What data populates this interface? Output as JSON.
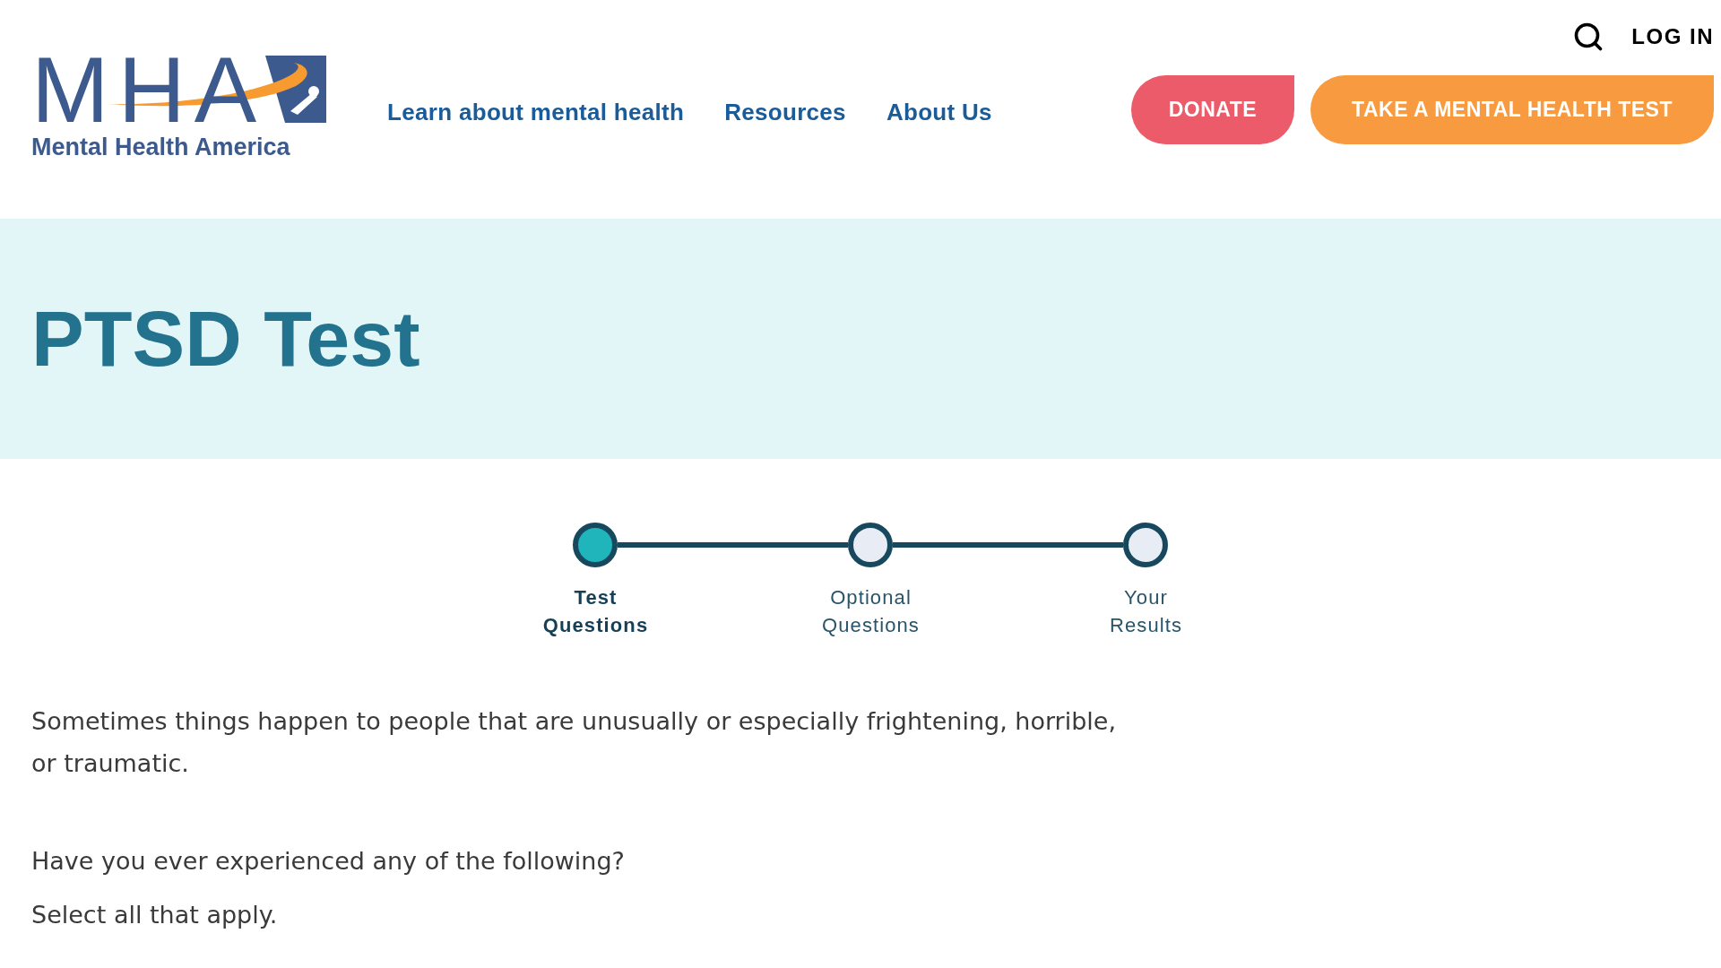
{
  "header": {
    "logo": {
      "letters": "MHA",
      "name": "Mental Health America"
    },
    "nav": [
      "Learn about mental health",
      "Resources",
      "About Us"
    ],
    "login": "LOG IN",
    "buttons": [
      {
        "label": "DONATE",
        "kind": "donate"
      },
      {
        "label": "TAKE A MENTAL HEALTH TEST",
        "kind": "test"
      }
    ]
  },
  "banner": {
    "title": "PTSD Test"
  },
  "stepper": {
    "steps": [
      {
        "label": "Test Questions",
        "selected": true
      },
      {
        "label": "Optional Questions",
        "selected": false
      },
      {
        "label": "Your Results",
        "selected": false
      }
    ]
  },
  "content": {
    "intro": "Sometimes things happen to people that are unusually or especially frightening, horrible, or traumatic.",
    "prompt": "Have you ever experienced any of the following?",
    "instruction": "Select all that apply."
  }
}
